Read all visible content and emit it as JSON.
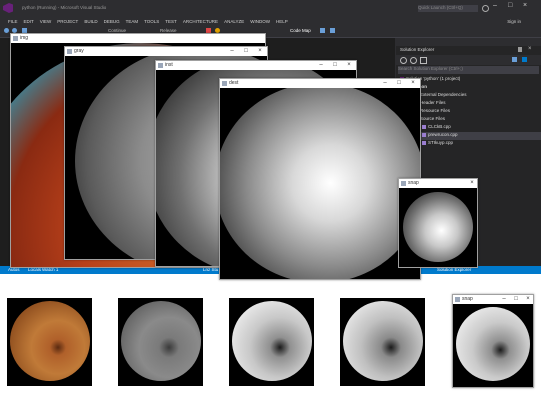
{
  "vs": {
    "title": "python (Running) - Microsoft Visual Studio",
    "quick_launch_placeholder": "Quick Launch (Ctrl+Q)",
    "sign_in": "Sign in",
    "menu": [
      "FILE",
      "EDIT",
      "VIEW",
      "PROJECT",
      "BUILD",
      "DEBUG",
      "TEAM",
      "TOOLS",
      "TEST",
      "ARCHITECTURE",
      "ANALYZE",
      "WINDOW",
      "HELP"
    ],
    "toolbar": {
      "continue": "Continue",
      "release": "Release",
      "code_map": "Code Map"
    },
    "solution_explorer": {
      "title": "Solution Explorer",
      "search_placeholder": "Search Solution Explorer (Ctrl+;)",
      "items": [
        "Solution 'python' (1 project)",
        "python",
        "External Dependencies",
        "Header Files",
        "Resource Files",
        "Source Files",
        "CLCkB.cpp",
        "prewrucon.cpp",
        "STIkuyp.cpp"
      ]
    },
    "status_tabs": [
      "Autos",
      "Locals",
      "Watch 1"
    ],
    "status_right": "Solution Explorer",
    "status_mid": "Lnz Stu"
  },
  "windows": [
    {
      "title": "img"
    },
    {
      "title": "gray"
    },
    {
      "title": "inst"
    },
    {
      "title": "dest"
    },
    {
      "title": "snap"
    }
  ],
  "thumbnails": [
    {
      "caption": ""
    },
    {
      "caption": ""
    },
    {
      "caption": ""
    },
    {
      "caption": ""
    },
    {
      "caption": "snap"
    }
  ],
  "colors": {
    "vs_dark": "#2d2d30",
    "vs_blue": "#007acc",
    "fundus_color": "#b8541e",
    "gray_fundus": "#8c8c8c"
  }
}
